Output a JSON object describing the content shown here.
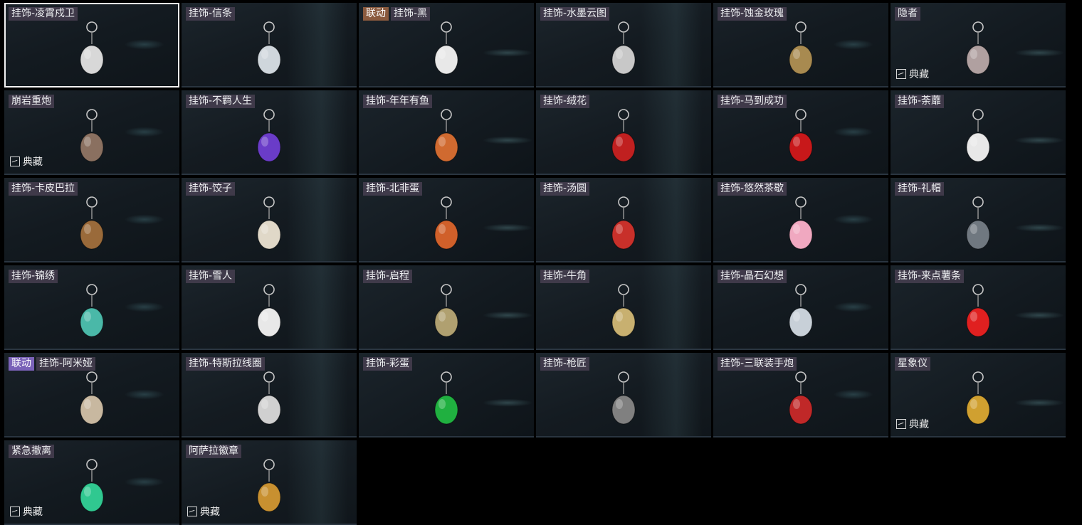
{
  "grid": {
    "items": [
      {
        "tag": "",
        "tag_color": "",
        "name": "挂饰-凌霄戍卫",
        "collection": "",
        "selected": true,
        "icon": "rocket-charm-icon",
        "color": "#d8d8d8"
      },
      {
        "tag": "",
        "tag_color": "",
        "name": "挂饰-信条",
        "collection": "",
        "selected": false,
        "icon": "goblet-charm-icon",
        "color": "#cfd6dc"
      },
      {
        "tag": "联动",
        "tag_color": "orange",
        "name": "挂饰-黑",
        "collection": "",
        "selected": false,
        "icon": "card-charm-icon",
        "color": "#e8e8e8"
      },
      {
        "tag": "",
        "tag_color": "",
        "name": "挂饰-水墨云图",
        "collection": "",
        "selected": false,
        "icon": "ink-ball-charm-icon",
        "color": "#c8c8c8"
      },
      {
        "tag": "",
        "tag_color": "",
        "name": "挂饰-蚀金玫瑰",
        "collection": "",
        "selected": false,
        "icon": "gold-rose-charm-icon",
        "color": "#a88a50"
      },
      {
        "tag": "",
        "tag_color": "",
        "name": "隐者",
        "collection": "典藏",
        "selected": false,
        "icon": "tarot-card-charm-icon",
        "color": "#b0a0a0"
      },
      {
        "tag": "",
        "tag_color": "",
        "name": "崩岩重炮",
        "collection": "典藏",
        "selected": false,
        "icon": "rock-soldier-charm-icon",
        "color": "#8a7060"
      },
      {
        "tag": "",
        "tag_color": "",
        "name": "挂饰-不羁人生",
        "collection": "",
        "selected": false,
        "icon": "sneaker-charm-icon",
        "color": "#6a3cc8"
      },
      {
        "tag": "",
        "tag_color": "",
        "name": "挂饰-年年有鱼",
        "collection": "",
        "selected": false,
        "icon": "fish-plate-charm-icon",
        "color": "#d06a30"
      },
      {
        "tag": "",
        "tag_color": "",
        "name": "挂饰-绒花",
        "collection": "",
        "selected": false,
        "icon": "red-flower-charm-icon",
        "color": "#c02020"
      },
      {
        "tag": "",
        "tag_color": "",
        "name": "挂饰-马到成功",
        "collection": "",
        "selected": false,
        "icon": "red-horse-charm-icon",
        "color": "#c8181a"
      },
      {
        "tag": "",
        "tag_color": "",
        "name": "挂饰-荼蘼",
        "collection": "",
        "selected": false,
        "icon": "white-flower-charm-icon",
        "color": "#e8e8e8"
      },
      {
        "tag": "",
        "tag_color": "",
        "name": "挂饰-卡皮巴拉",
        "collection": "",
        "selected": false,
        "icon": "capybara-charm-icon",
        "color": "#9a6a3a"
      },
      {
        "tag": "",
        "tag_color": "",
        "name": "挂饰-饺子",
        "collection": "",
        "selected": false,
        "icon": "dumpling-plate-charm-icon",
        "color": "#e0d8c8"
      },
      {
        "tag": "",
        "tag_color": "",
        "name": "挂饰-北非蛋",
        "collection": "",
        "selected": false,
        "icon": "shakshuka-charm-icon",
        "color": "#d0602a"
      },
      {
        "tag": "",
        "tag_color": "",
        "name": "挂饰-汤圆",
        "collection": "",
        "selected": false,
        "icon": "tangyuan-bowl-charm-icon",
        "color": "#c8302a"
      },
      {
        "tag": "",
        "tag_color": "",
        "name": "挂饰-悠然茶歇",
        "collection": "",
        "selected": false,
        "icon": "cupcake-charm-icon",
        "color": "#f0a8c0"
      },
      {
        "tag": "",
        "tag_color": "",
        "name": "挂饰-礼帽",
        "collection": "",
        "selected": false,
        "icon": "top-hat-charm-icon",
        "color": "#707880"
      },
      {
        "tag": "",
        "tag_color": "",
        "name": "挂饰-锦绣",
        "collection": "",
        "selected": false,
        "icon": "butterfly-charm-icon",
        "color": "#4ab8a8"
      },
      {
        "tag": "",
        "tag_color": "",
        "name": "挂饰-雪人",
        "collection": "",
        "selected": false,
        "icon": "snowman-charm-icon",
        "color": "#e8e8e8"
      },
      {
        "tag": "",
        "tag_color": "",
        "name": "挂饰-启程",
        "collection": "",
        "selected": false,
        "icon": "medallion-charm-icon",
        "color": "#b0a070"
      },
      {
        "tag": "",
        "tag_color": "",
        "name": "挂饰-牛角",
        "collection": "",
        "selected": false,
        "icon": "bull-horns-charm-icon",
        "color": "#c8b070"
      },
      {
        "tag": "",
        "tag_color": "",
        "name": "挂饰-晶石幻想",
        "collection": "",
        "selected": false,
        "icon": "crystal-cube-charm-icon",
        "color": "#c8d0d8"
      },
      {
        "tag": "",
        "tag_color": "",
        "name": "挂饰-来点薯条",
        "collection": "",
        "selected": false,
        "icon": "fries-charm-icon",
        "color": "#e02020"
      },
      {
        "tag": "联动",
        "tag_color": "purple",
        "name": "挂饰-阿米娅",
        "collection": "",
        "selected": false,
        "icon": "bunny-charm-icon",
        "color": "#c8b8a0"
      },
      {
        "tag": "",
        "tag_color": "",
        "name": "挂饰-特斯拉线圈",
        "collection": "",
        "selected": false,
        "icon": "tesla-coil-charm-icon",
        "color": "#d0d0d0"
      },
      {
        "tag": "",
        "tag_color": "",
        "name": "挂饰-彩蛋",
        "collection": "",
        "selected": false,
        "icon": "green-egg-charm-icon",
        "color": "#20b040"
      },
      {
        "tag": "",
        "tag_color": "",
        "name": "挂饰-枪匠",
        "collection": "",
        "selected": false,
        "icon": "gun-case-charm-icon",
        "color": "#808080"
      },
      {
        "tag": "",
        "tag_color": "",
        "name": "挂饰-三联装手炮",
        "collection": "",
        "selected": false,
        "icon": "hand-cannon-charm-icon",
        "color": "#c02828"
      },
      {
        "tag": "",
        "tag_color": "",
        "name": "星象仪",
        "collection": "典藏",
        "selected": false,
        "icon": "astrolabe-charm-icon",
        "color": "#d0a030"
      },
      {
        "tag": "",
        "tag_color": "",
        "name": "紧急撤离",
        "collection": "典藏",
        "selected": false,
        "icon": "exit-sign-charm-icon",
        "color": "#30c890"
      },
      {
        "tag": "",
        "tag_color": "",
        "name": "阿萨拉徽章",
        "collection": "典藏",
        "selected": false,
        "icon": "badge-charm-icon",
        "color": "#c89030"
      }
    ]
  }
}
